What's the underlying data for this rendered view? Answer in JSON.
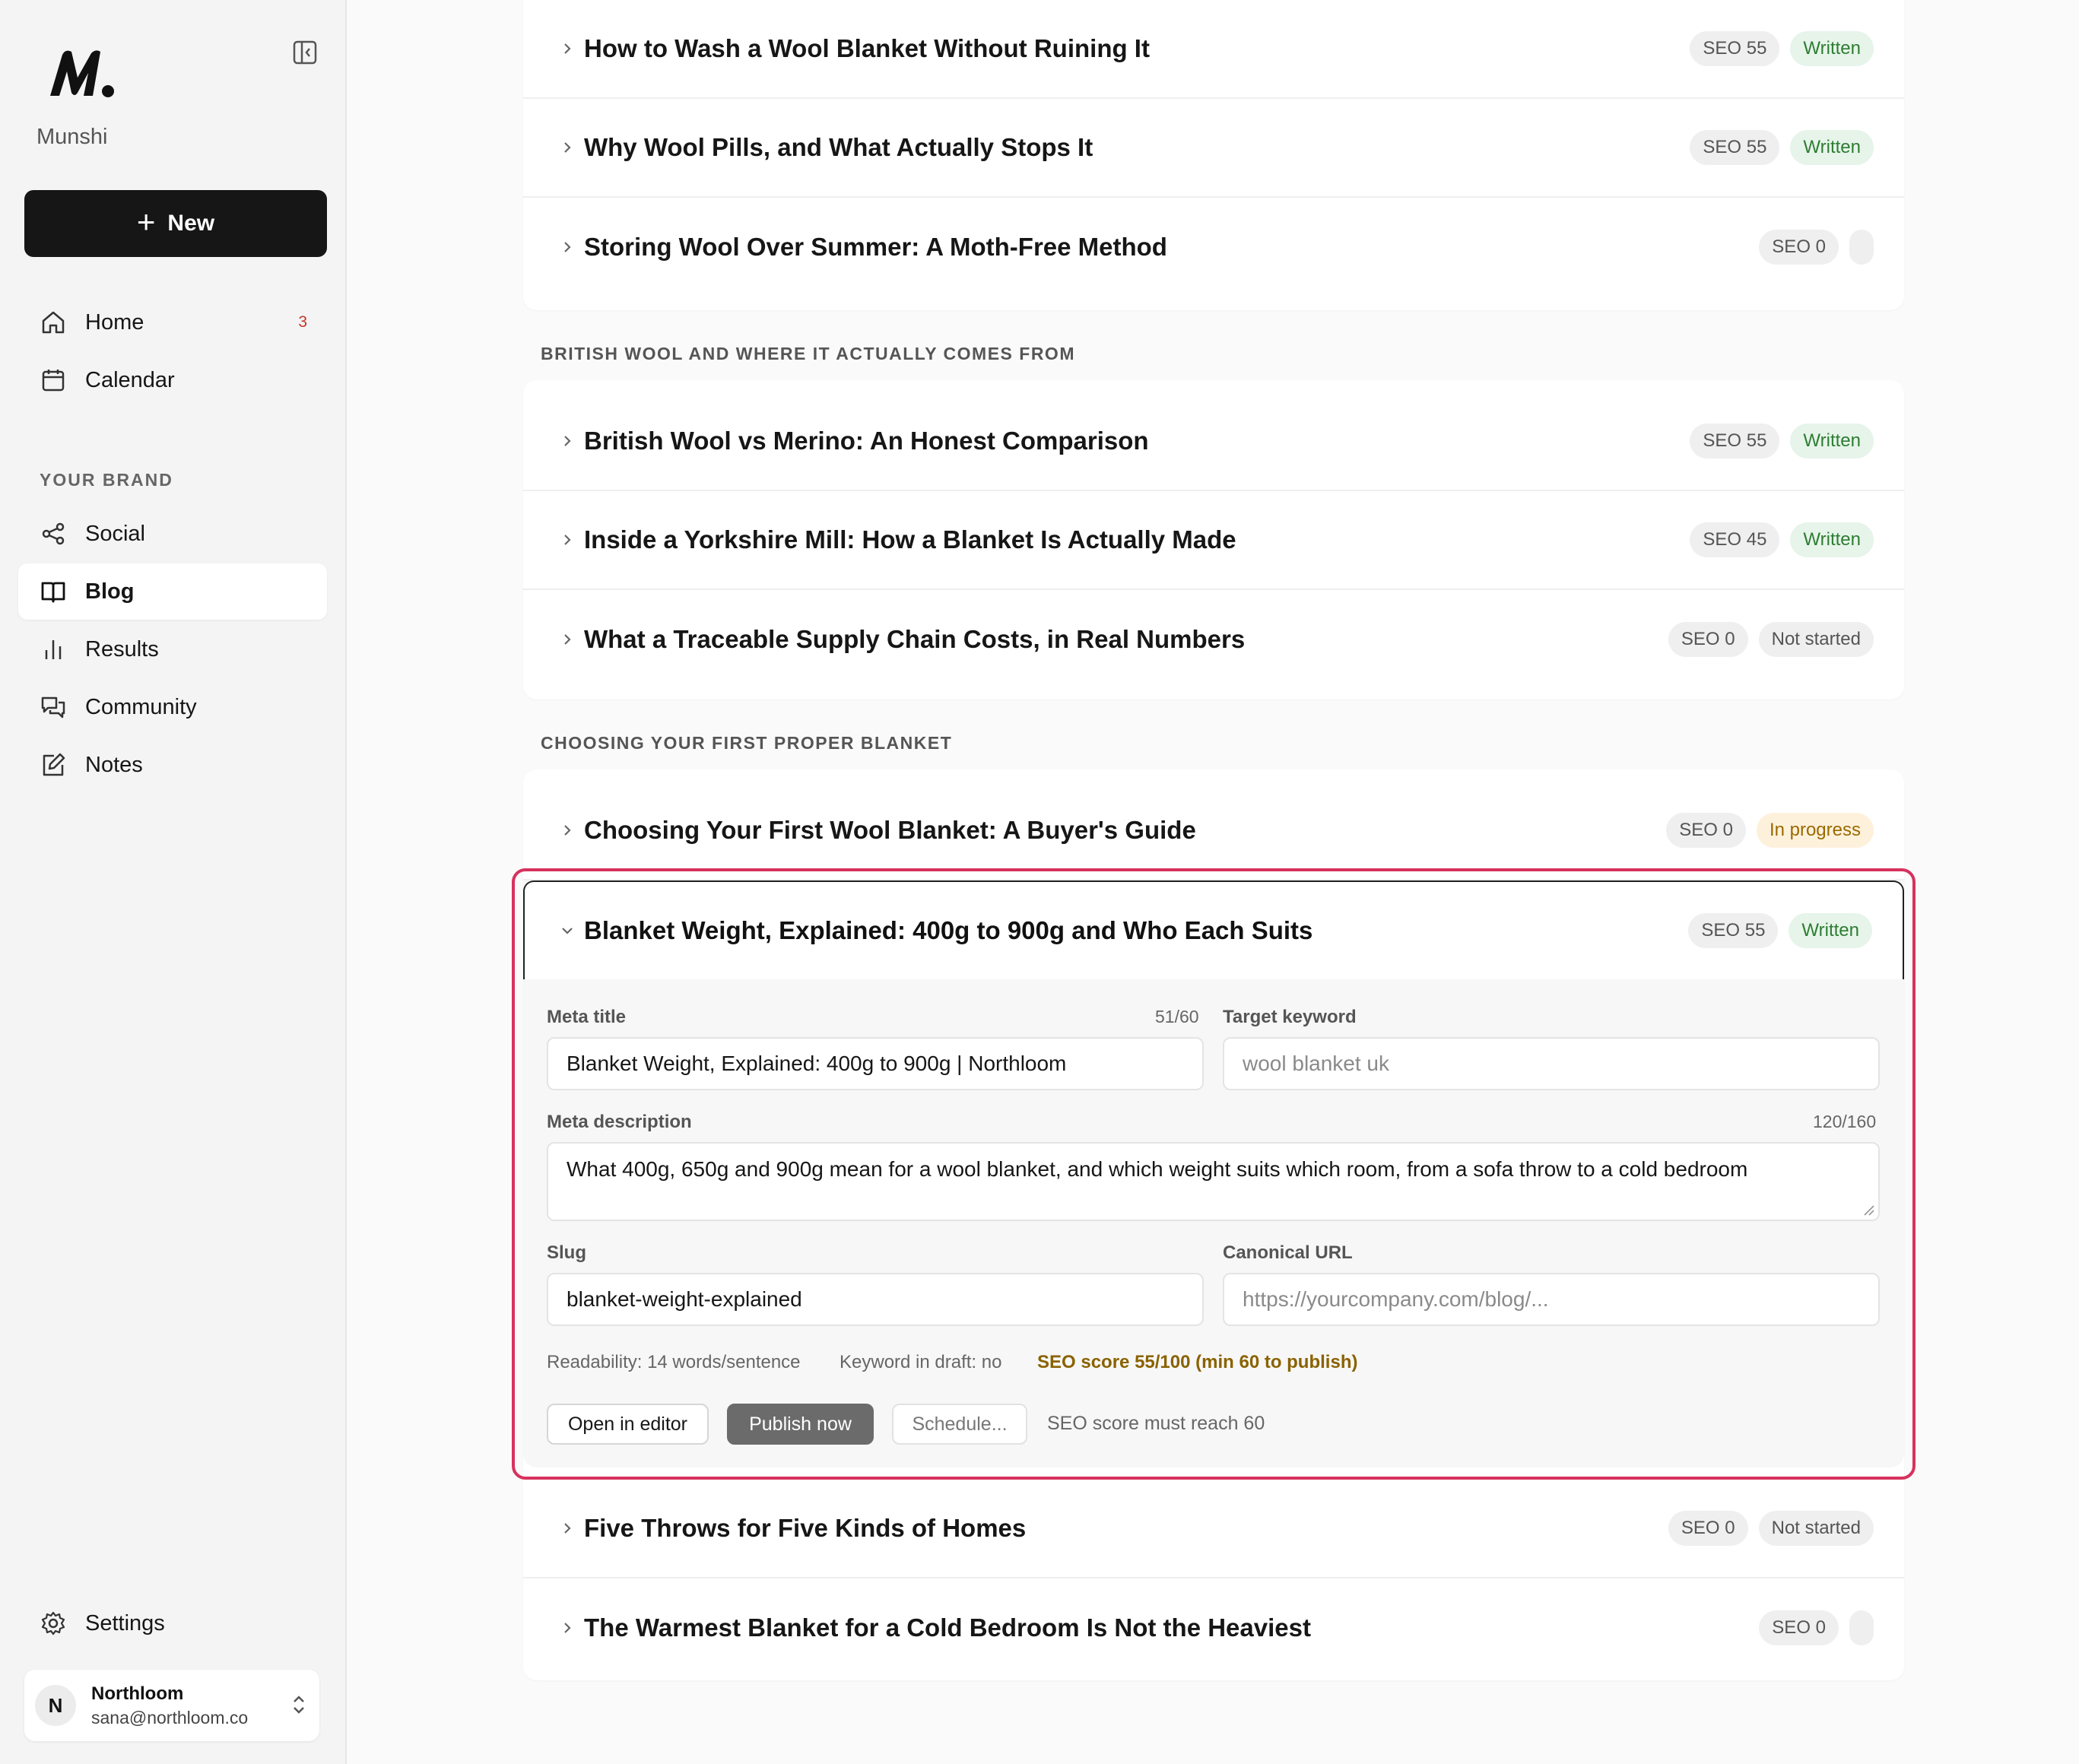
{
  "app": {
    "brand": "Munshi"
  },
  "sidebar": {
    "new_label": "New",
    "nav": [
      {
        "label": "Home",
        "badge": "3",
        "icon": "home-icon"
      },
      {
        "label": "Calendar",
        "icon": "calendar-icon"
      }
    ],
    "section_label": "YOUR BRAND",
    "brand_nav": [
      {
        "label": "Social",
        "icon": "share-icon"
      },
      {
        "label": "Blog",
        "icon": "book-icon",
        "active": true
      },
      {
        "label": "Results",
        "icon": "bar-chart-icon"
      },
      {
        "label": "Community",
        "icon": "chat-icon"
      },
      {
        "label": "Notes",
        "icon": "edit-icon"
      }
    ],
    "settings_label": "Settings",
    "account": {
      "initial": "N",
      "name": "Northloom",
      "email": "sana@northloom.co"
    }
  },
  "groups": [
    {
      "label": "",
      "posts": [
        {
          "title": "How to Wash a Wool Blanket Without Ruining It",
          "seo": "SEO 55",
          "status": "Written"
        },
        {
          "title": "Why Wool Pills, and What Actually Stops It",
          "seo": "SEO 55",
          "status": "Written"
        },
        {
          "title": "Storing Wool Over Summer: A Moth-Free Method",
          "seo": "SEO 0",
          "status": ""
        }
      ]
    },
    {
      "label": "BRITISH WOOL AND WHERE IT ACTUALLY COMES FROM",
      "posts": [
        {
          "title": "British Wool vs Merino: An Honest Comparison",
          "seo": "SEO 55",
          "status": "Written"
        },
        {
          "title": "Inside a Yorkshire Mill: How a Blanket Is Actually Made",
          "seo": "SEO 45",
          "status": "Written"
        },
        {
          "title": "What a Traceable Supply Chain Costs, in Real Numbers",
          "seo": "SEO 0",
          "status": "Not started"
        }
      ]
    },
    {
      "label": "CHOOSING YOUR FIRST PROPER BLANKET",
      "posts": [
        {
          "title": "Choosing Your First Wool Blanket: A Buyer's Guide",
          "seo": "SEO 0",
          "status": "In progress"
        },
        {
          "title": "Five Throws for Five Kinds of Homes",
          "seo": "SEO 0",
          "status": "Not started"
        },
        {
          "title": "The Warmest Blanket for a Cold Bedroom Is Not the Heaviest",
          "seo": "SEO 0",
          "status": ""
        }
      ]
    }
  ],
  "expanded": {
    "title": "Blanket Weight, Explained: 400g to 900g and Who Each Suits",
    "seo": "SEO 55",
    "status": "Written",
    "meta_title_label": "Meta title",
    "meta_title_count": "51/60",
    "meta_title_value": "Blanket Weight, Explained: 400g to 900g | Northloom",
    "target_keyword_label": "Target keyword",
    "target_keyword_placeholder": "wool blanket uk",
    "meta_description_label": "Meta description",
    "meta_description_count": "120/160",
    "meta_description_value": "What 400g, 650g and 900g mean for a wool blanket, and which weight suits which room, from a sofa throw to a cold bedroom",
    "slug_label": "Slug",
    "slug_value": "blanket-weight-explained",
    "canonical_label": "Canonical URL",
    "canonical_placeholder": "https://yourcompany.com/blog/...",
    "readability": "Readability: 14 words/sentence",
    "keyword_in_draft": "Keyword in draft: no",
    "seo_score": "SEO score 55/100 (min 60 to publish)",
    "open_editor_label": "Open in editor",
    "publish_label": "Publish now",
    "schedule_label": "Schedule...",
    "publish_hint": "SEO score must reach 60"
  },
  "colors": {
    "accent_outline": "#d7325e",
    "written": "#2e7d32",
    "in_progress": "#9a6a00",
    "sidebar_bg": "#f4f4f4"
  }
}
